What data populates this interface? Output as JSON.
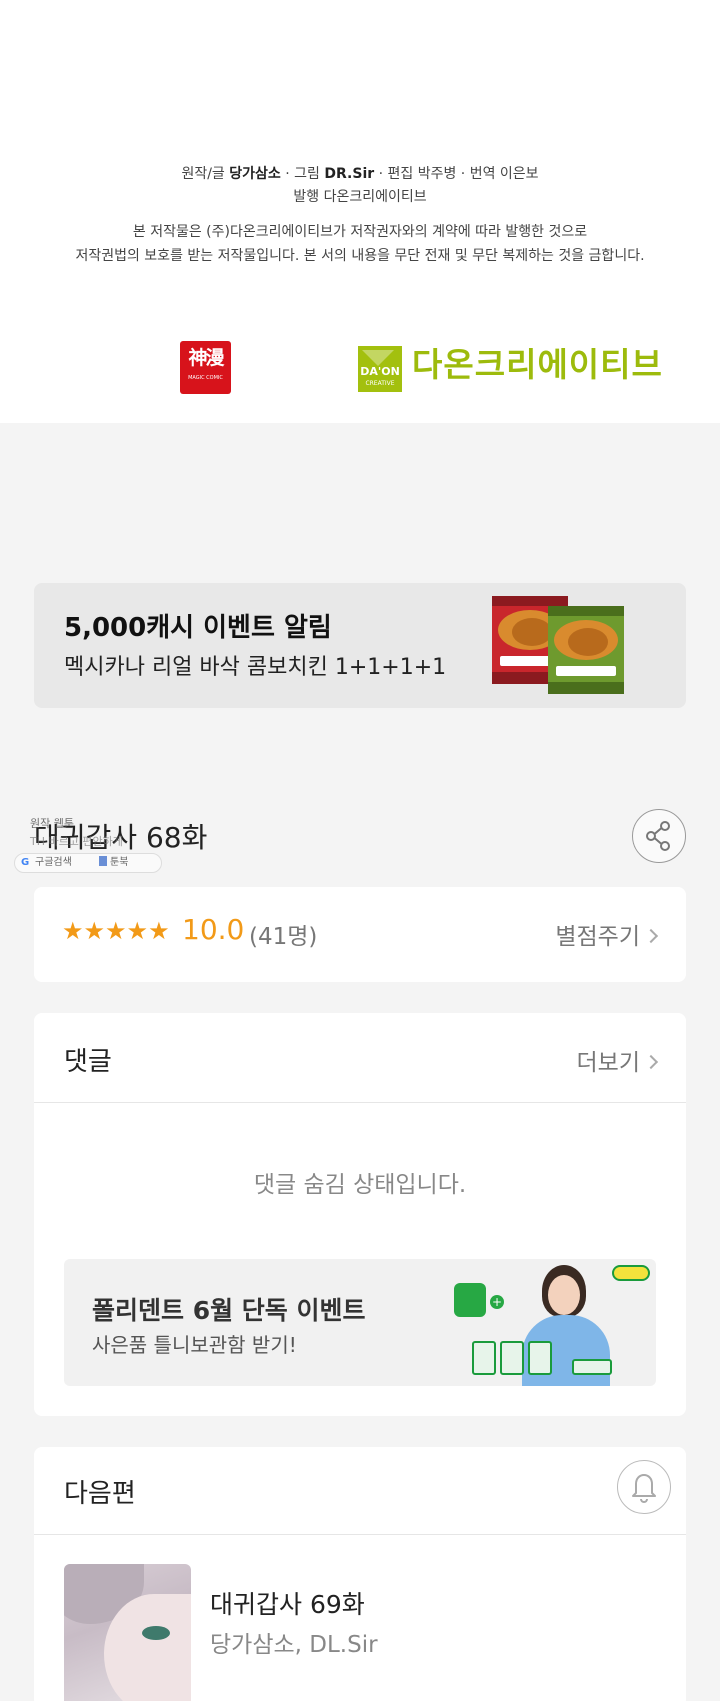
{
  "credits": {
    "line1": {
      "original_label": "원작/글",
      "original": "당가삼소",
      "art_label": "· 그림",
      "art": "DR.Sir",
      "editor": "· 편집 박주병 · 번역 이은보"
    },
    "publisher": "발행 다온크리에이티브",
    "notice_line1": "본 저작물은 (주)다온크리에이티브가 저작권자와의 계약에 따라 발행한 것으로",
    "notice_line2": "저작권법의 보호를 받는 저작물입니다. 본 서의 내용을 무단 전재 및 무단 복제하는 것을 금합니다.",
    "logo_shenman": {
      "big": "神漫",
      "small": "MAGIC COMIC"
    },
    "logo_daon": {
      "mark_text": "DA'ON",
      "mark_sub": "CREATIVE",
      "name": "다온크리에이티브"
    }
  },
  "event_banner": {
    "title": "5,000캐시 이벤트 알림",
    "subtitle": "멕시카나 리얼 바삭 콤보치킨 1+1+1+1"
  },
  "episode": {
    "title": "대귀갑사 68화",
    "overlay_line1": "원작 웹툰",
    "overlay_line2": "TH 바르고 편안하게",
    "search_pill": {
      "google": "G",
      "google_label": "구글검색",
      "book_label": "툰북"
    }
  },
  "rating": {
    "stars": "★★★★★",
    "score": "10.0",
    "count": "(41명)",
    "action": "별점주기"
  },
  "comments": {
    "title": "댓글",
    "more": "더보기",
    "hidden_message": "댓글 숨김 상태입니다.",
    "ad": {
      "title": "폴리덴트 6월 단독 이벤트",
      "subtitle": "사은품 틀니보관함 받기!"
    }
  },
  "next": {
    "title": "다음편",
    "episode_title": "대귀갑사 69화",
    "authors": "당가삼소, DL.Sir"
  },
  "colors": {
    "accent_orange": "#f29a18",
    "daon_green": "#9dbb0c",
    "shenman_red": "#d7131b"
  },
  "icons": [
    "share-icon",
    "chevron-right-icon",
    "bell-icon",
    "google-icon",
    "book-icon"
  ]
}
